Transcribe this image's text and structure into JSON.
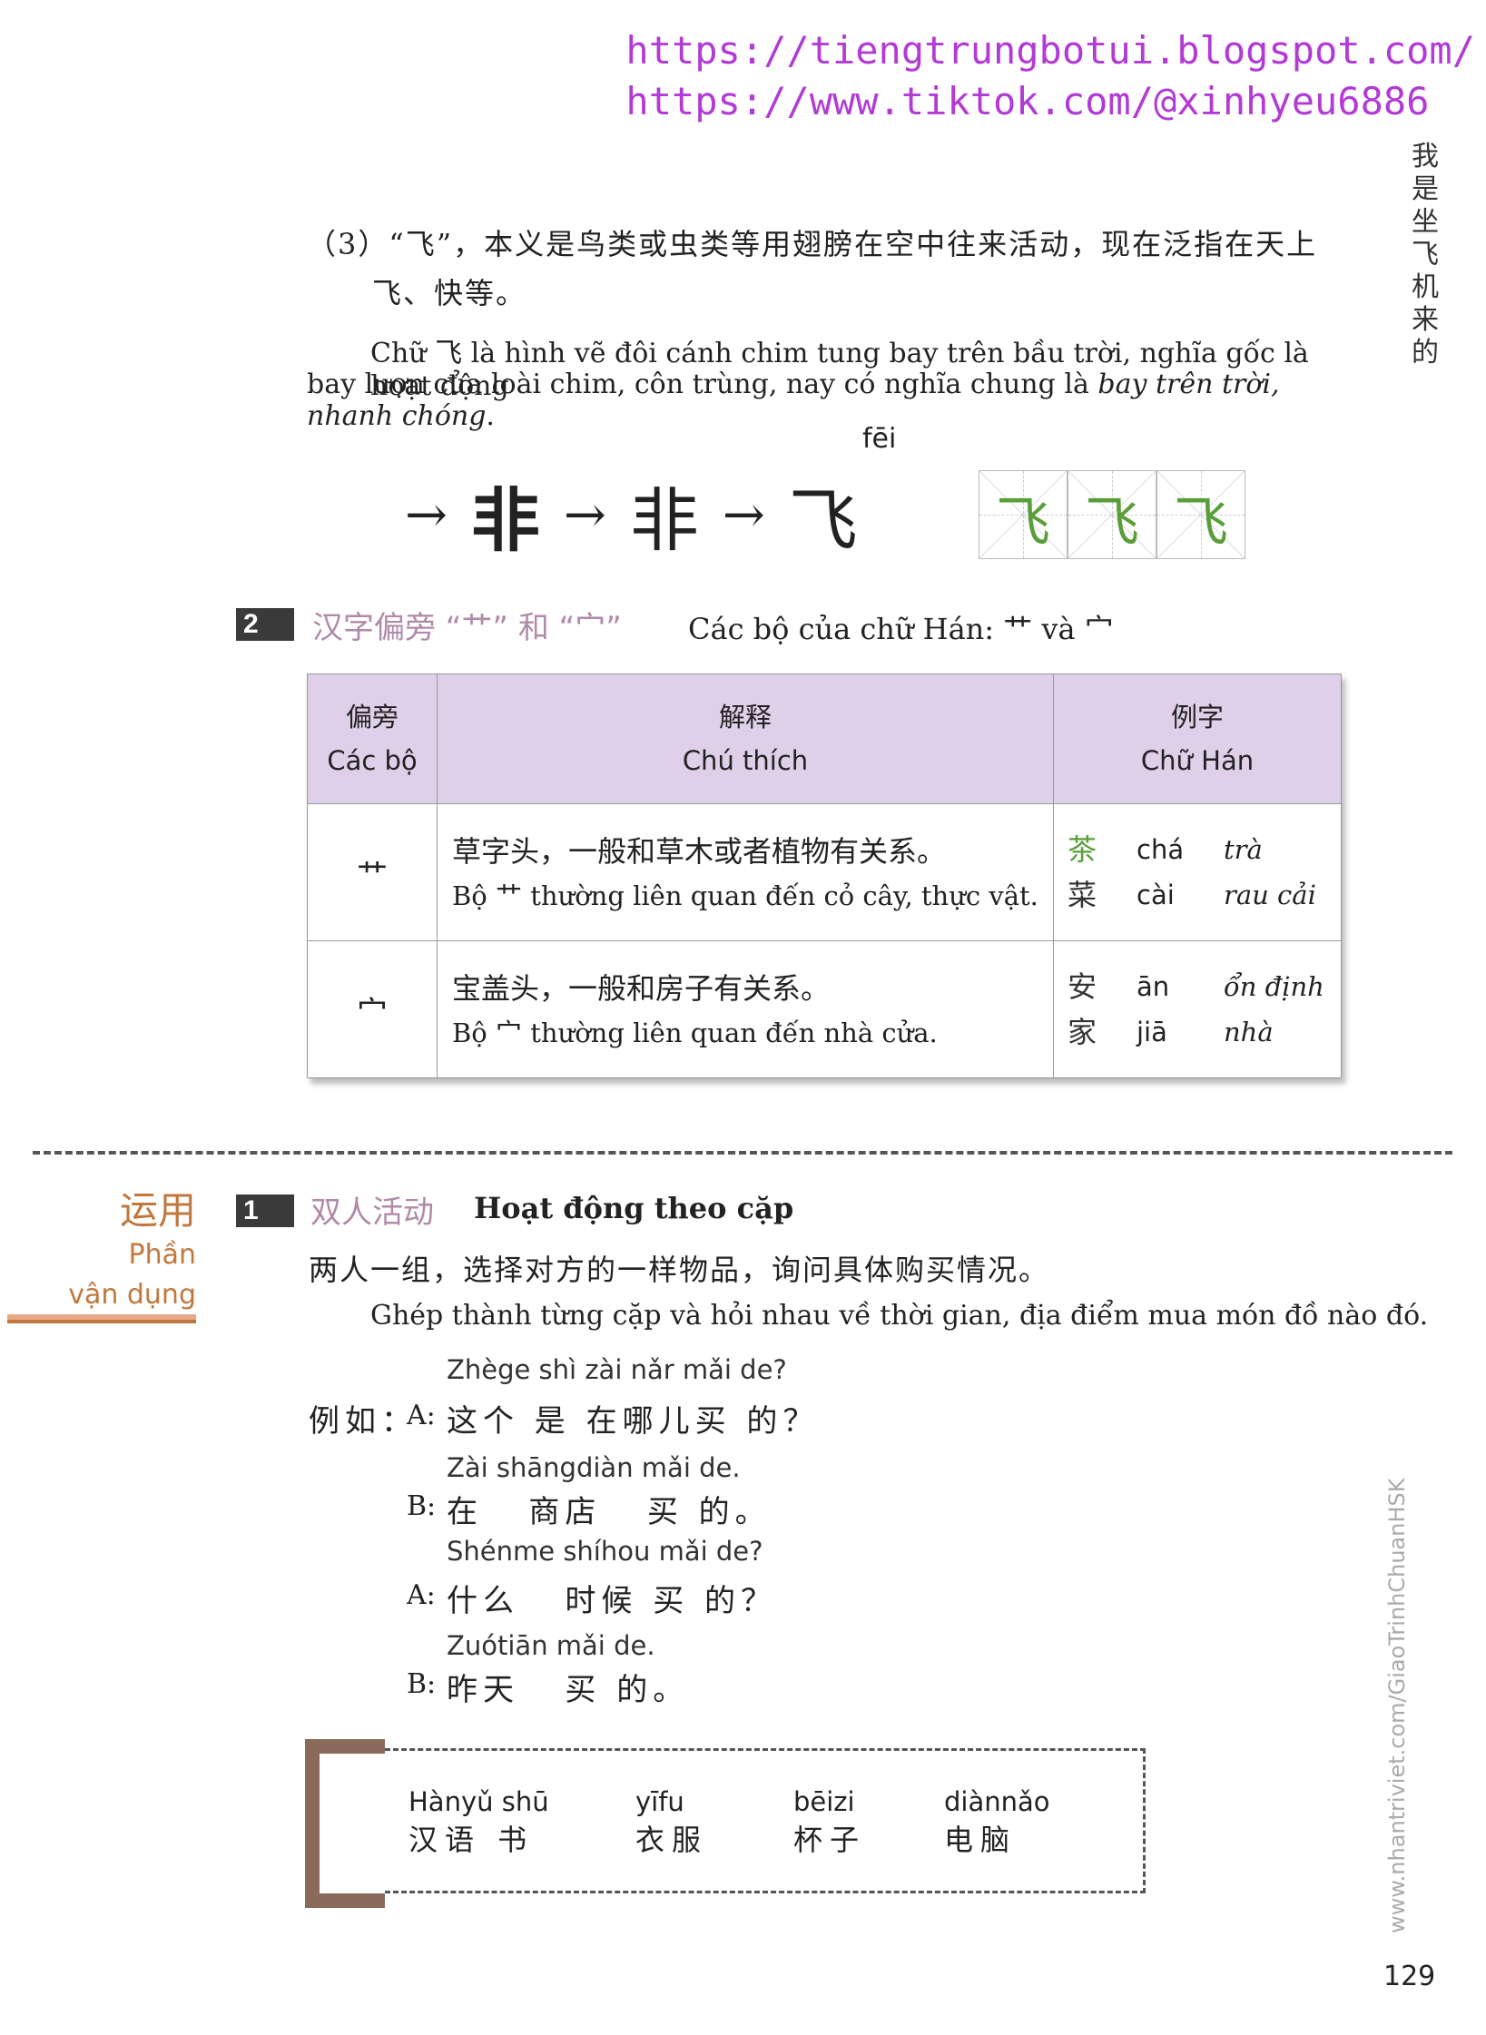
{
  "header": {
    "url1": "https://tiengtrungbotui.blogspot.com/",
    "url2": "https://www.tiktok.com/@xinhyeu6886"
  },
  "side_title": "我是坐飞机来的",
  "side_watermark": "www.nhantriviet.com/GiaoTrinhChuanHSK",
  "intro": {
    "zh_line1": "（3）“飞”，本义是鸟类或虫类等用翅膀在空中往来活动，现在泛指在天上",
    "zh_line2": "飞、快等。",
    "vi_line1": "Chữ 飞 là hình vẽ đôi cánh chim tung bay trên bầu trời, nghĩa gốc là hoạt động",
    "vi_line2_plain": "bay lượn của loài chim, côn trùng, nay có nghĩa chung là ",
    "vi_line2_italic": "bay trên trời, nhanh chóng",
    "vi_line2_end": "."
  },
  "evolution": {
    "pinyin": "fēi",
    "glyphs": [
      "𠃧",
      "非",
      "非",
      "飞"
    ],
    "arrow": "→",
    "practice": [
      "飞",
      "飞",
      "飞"
    ]
  },
  "section2": {
    "num": "2",
    "zh": "汉字偏旁 “艹” 和 “宀”",
    "vi": "Các bộ của chữ Hán: 艹 và 宀"
  },
  "radical_table": {
    "headers": [
      {
        "zh": "偏旁",
        "vi": "Các bộ"
      },
      {
        "zh": "解释",
        "vi": "Chú thích"
      },
      {
        "zh": "例字",
        "vi": "Chữ Hán"
      }
    ],
    "rows": [
      {
        "radical": "艹",
        "exp_zh": "草字头，一般和草木或者植物有关系。",
        "exp_vi": "Bộ 艹 thường liên quan đến cỏ cây, thực vật.",
        "examples": [
          {
            "hz": "茶",
            "py": "chá",
            "mn": "trà"
          },
          {
            "hz": "菜",
            "py": "cài",
            "mn": "rau cải"
          }
        ]
      },
      {
        "radical": "宀",
        "exp_zh": "宝盖头，一般和房子有关系。",
        "exp_vi": "Bộ 宀 thường liên quan đến nhà cửa.",
        "examples": [
          {
            "hz": "安",
            "py": "ān",
            "mn": "ổn định"
          },
          {
            "hz": "家",
            "py": "jiā",
            "mn": "nhà"
          }
        ]
      }
    ]
  },
  "apply": {
    "zh": "运用",
    "vi1": "Phần",
    "vi2": "vận dụng"
  },
  "section1": {
    "num": "1",
    "zh": "双人活动",
    "vi": "Hoạt động theo cặp",
    "instr_zh": "两人一组，选择对方的一样物品，询问具体购买情况。",
    "instr_vi": "Ghép thành từng cặp và hỏi nhau về thời gian, địa điểm mua món đồ nào đó."
  },
  "dialogue": {
    "lead": "例如：",
    "lines": [
      {
        "py": "Zhège shì zài nǎr mǎi de?",
        "spk": "A:",
        "zh": "这个 是 在哪儿买 的？"
      },
      {
        "py": "Zài shāngdiàn mǎi de.",
        "spk": "B:",
        "zh": "在   商店   买 的。"
      },
      {
        "py": "Shénme shíhou mǎi de?",
        "spk": "A:",
        "zh": "什么   时候 买 的？"
      },
      {
        "py": "Zuótiān mǎi de.",
        "spk": "B:",
        "zh": "昨天   买 的。"
      }
    ]
  },
  "words": [
    {
      "py": "Hànyǔ shū",
      "hz": "汉语 书"
    },
    {
      "py": "yīfu",
      "hz": "衣服"
    },
    {
      "py": "bēizi",
      "hz": "杯子"
    },
    {
      "py": "diànnǎo",
      "hz": "电脑"
    }
  ],
  "page_number": "129",
  "colors": {
    "url": "#b23bd6",
    "accent_orange": "#c1783e",
    "header_purple": "#e0cfe8",
    "green": "#5a9e3a",
    "bracket_brown": "#8a6a5a"
  }
}
